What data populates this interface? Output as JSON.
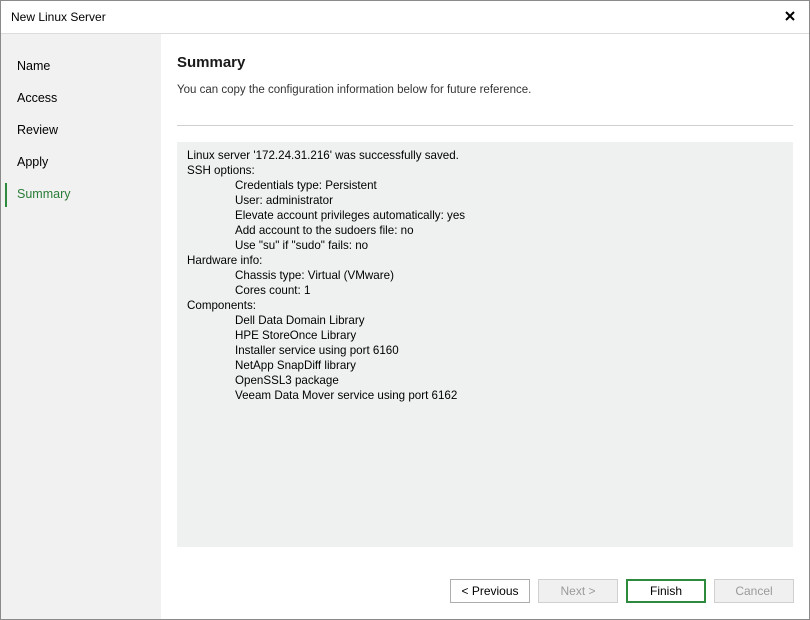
{
  "window": {
    "title": "New Linux Server"
  },
  "sidebar": {
    "items": [
      {
        "label": "Name"
      },
      {
        "label": "Access"
      },
      {
        "label": "Review"
      },
      {
        "label": "Apply"
      },
      {
        "label": "Summary",
        "active": true
      }
    ]
  },
  "main": {
    "heading": "Summary",
    "subtitle": "You can copy the configuration information below for future reference.",
    "summary_lines": [
      "Linux server '172.24.31.216' was successfully saved.",
      "SSH options:",
      "Credentials type: Persistent",
      "User: administrator",
      "Elevate account privileges automatically: yes",
      "Add account to the sudoers file: no",
      "Use \"su\" if \"sudo\" fails: no",
      "Hardware info:",
      "Chassis type: Virtual (VMware)",
      "Cores count: 1",
      "Components:",
      "Dell Data Domain Library",
      "HPE StoreOnce Library",
      "Installer service using port 6160",
      "NetApp SnapDiff library",
      "OpenSSL3 package",
      "Veeam Data Mover service using port 6162"
    ]
  },
  "buttons": {
    "previous": "< Previous",
    "next": "Next >",
    "finish": "Finish",
    "cancel": "Cancel"
  },
  "colors": {
    "accent": "#2e8b3e",
    "sidebar_bg": "#f1f1f1",
    "summary_bg": "#eff1f0"
  },
  "icons": {
    "close": "close-icon"
  }
}
